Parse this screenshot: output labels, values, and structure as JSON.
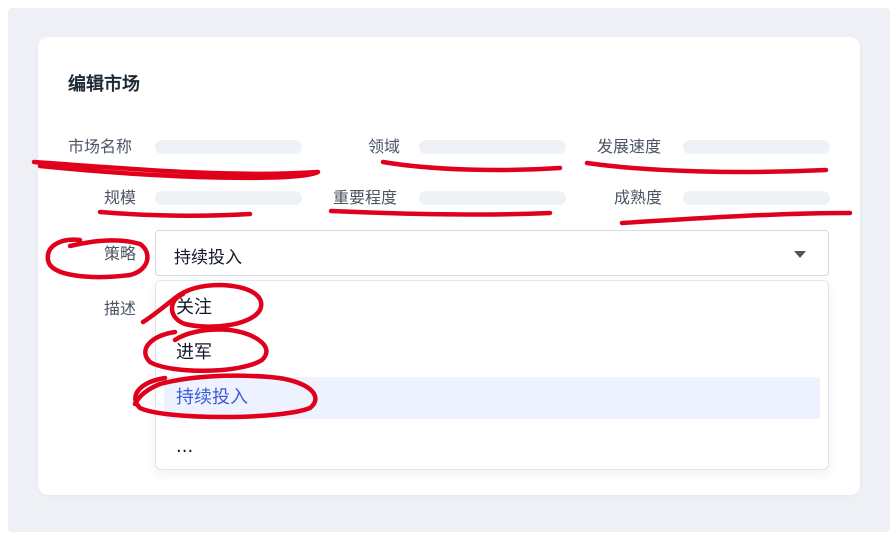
{
  "dialog": {
    "title": "编辑市场"
  },
  "fields": {
    "market_name": "市场名称",
    "domain": "领域",
    "growth_speed": "发展速度",
    "scale": "规模",
    "importance": "重要程度",
    "maturity": "成熟度",
    "strategy": "策略",
    "description": "描述"
  },
  "strategy_select": {
    "value": "持续投入",
    "options": [
      "关注",
      "进军",
      "持续投入",
      "..."
    ],
    "selected_index": 2
  },
  "colors": {
    "annotation": "#e0001b",
    "selected_bg": "#eef2ff",
    "selected_text": "#3b5bdb"
  }
}
